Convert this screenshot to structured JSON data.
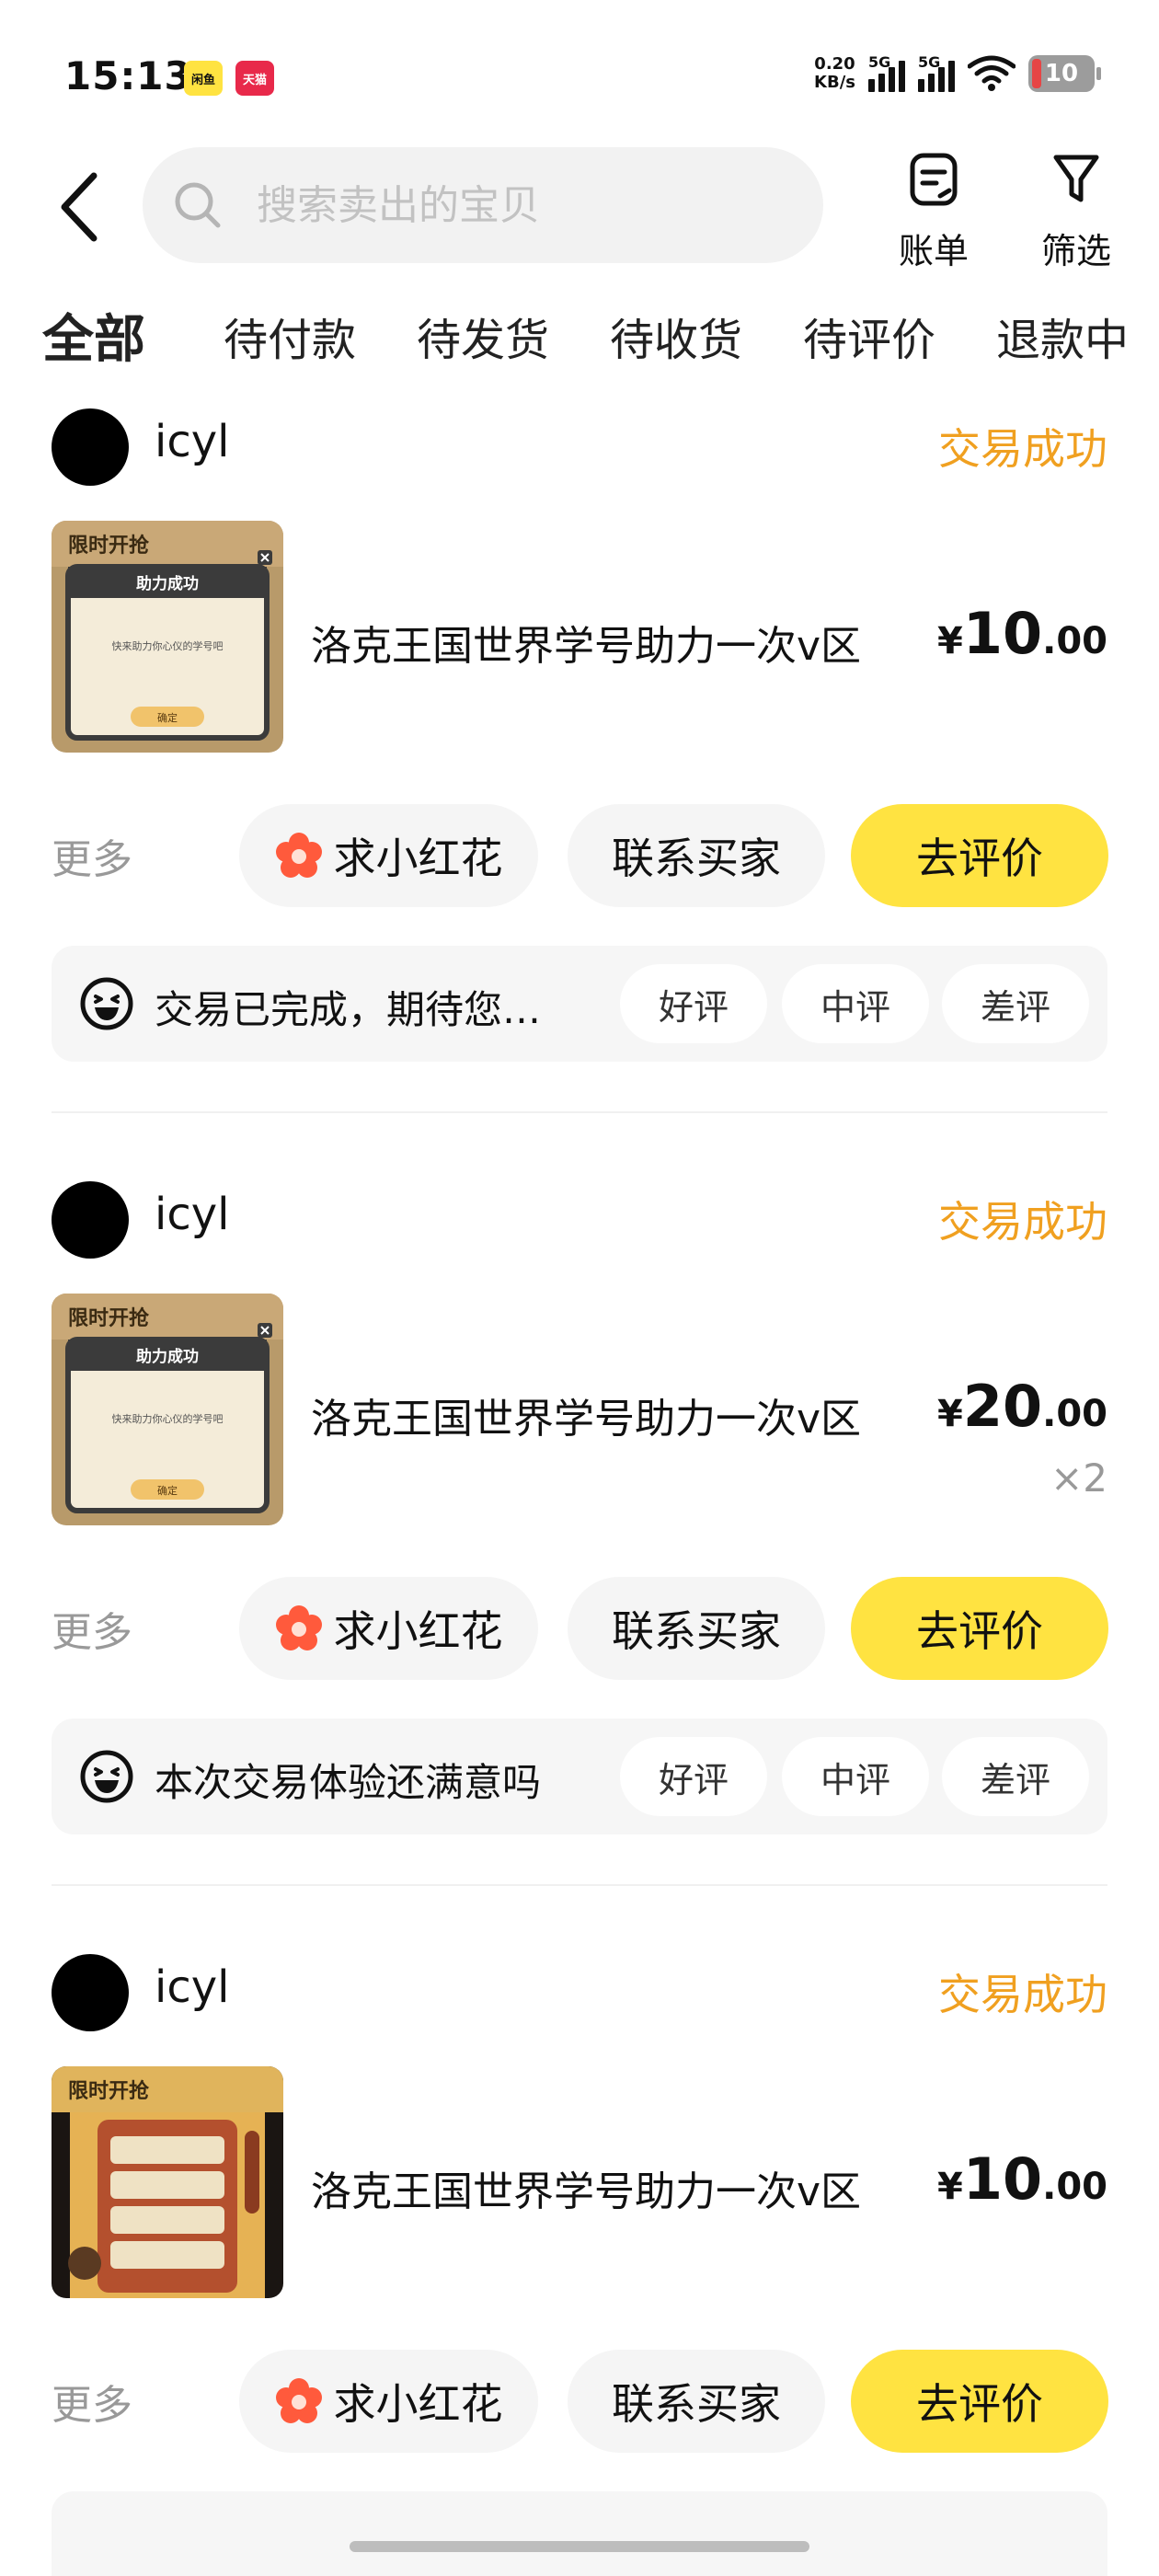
{
  "status_bar": {
    "time": "15:13",
    "app_badge_1": "闲鱼",
    "app_badge_2": "天猫",
    "net_speed": "0.20",
    "net_unit": "KB/s",
    "signal_1": "5G",
    "signal_2": "5G",
    "battery": "10"
  },
  "header": {
    "search_placeholder": "搜索卖出的宝贝",
    "bill_label": "账单",
    "filter_label": "筛选"
  },
  "tabs": [
    {
      "label": "全部"
    },
    {
      "label": "待付款"
    },
    {
      "label": "待发货"
    },
    {
      "label": "待收货"
    },
    {
      "label": "待评价"
    },
    {
      "label": "退款中"
    }
  ],
  "orders": [
    {
      "buyer": "icyl",
      "status": "交易成功",
      "title": "洛克王国世界学号助力一次v区",
      "currency": "¥",
      "price_int": "10",
      "price_dec": ".00",
      "qty": "",
      "more": "更多",
      "btn_flower": "求小红花",
      "btn_contact": "联系买家",
      "btn_review": "去评价",
      "rate_prompt": "交易已完成，期待您…",
      "rate_good": "好评",
      "rate_mid": "中评",
      "rate_bad": "差评"
    },
    {
      "buyer": "icyl",
      "status": "交易成功",
      "title": "洛克王国世界学号助力一次v区",
      "currency": "¥",
      "price_int": "20",
      "price_dec": ".00",
      "qty": "×2",
      "more": "更多",
      "btn_flower": "求小红花",
      "btn_contact": "联系买家",
      "btn_review": "去评价",
      "rate_prompt": "本次交易体验还满意吗",
      "rate_good": "好评",
      "rate_mid": "中评",
      "rate_bad": "差评"
    },
    {
      "buyer": "icyl",
      "status": "交易成功",
      "title": "洛克王国世界学号助力一次v区",
      "currency": "¥",
      "price_int": "10",
      "price_dec": ".00",
      "qty": "",
      "more": "更多",
      "btn_flower": "求小红花",
      "btn_contact": "联系买家",
      "btn_review": "去评价"
    }
  ],
  "thumb_text": {
    "banner": "限时开抢",
    "dialog_title": "助力成功",
    "dialog_body": "快来助力你心仪的学号吧",
    "dialog_ok": "确定"
  },
  "colors": {
    "accent_yellow": "#ffe341",
    "status_orange": "#f0a020",
    "flower_red": "#ff5a3c"
  }
}
